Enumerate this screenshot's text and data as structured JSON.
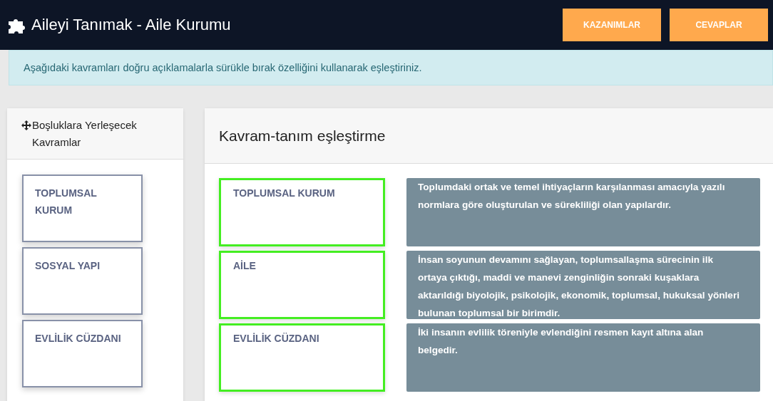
{
  "header": {
    "title": "Aileyi Tanımak - Aile Kurumu",
    "buttons": [
      "KAZANIMLAR",
      "CEVAPLAR"
    ]
  },
  "instruction": "Aşağıdaki kavramları doğru açıklamalarla sürükle bırak özelliğini kullanarak eşleştiriniz.",
  "concepts_panel": {
    "title": "Boşluklara Yerleşecek Kavramlar",
    "items": [
      "TOPLUMSAL KURUM",
      "SOSYAL YAPI",
      "EVLİLİK CÜZDANI"
    ]
  },
  "matching_panel": {
    "title": "Kavram-tanım eşleştirme",
    "rows": [
      {
        "answer": "TOPLUMSAL KURUM",
        "correct": true,
        "definition": "Toplumdaki ortak ve temel ihtiyaçların karşılanması amacıyla yazılı normlara göre oluşturulan ve sürekliliği olan yapılardır."
      },
      {
        "answer": "AİLE",
        "correct": true,
        "definition": "İnsan soyunun devamını sağlayan, toplumsallaşma sürecinin ilk ortaya çıktığı, maddi ve manevi zenginliğin sonraki kuşaklara aktarıldığı biyolojik, psikolojik, ekonomik, toplumsal, hukuksal yönleri bulunan toplumsal bir birimdir."
      },
      {
        "answer": "EVLİLİK CÜZDANI",
        "correct": true,
        "definition": "İki insanın evlilik töreniyle evlendiğini resmen kayıt altına alan belgedir."
      }
    ]
  }
}
